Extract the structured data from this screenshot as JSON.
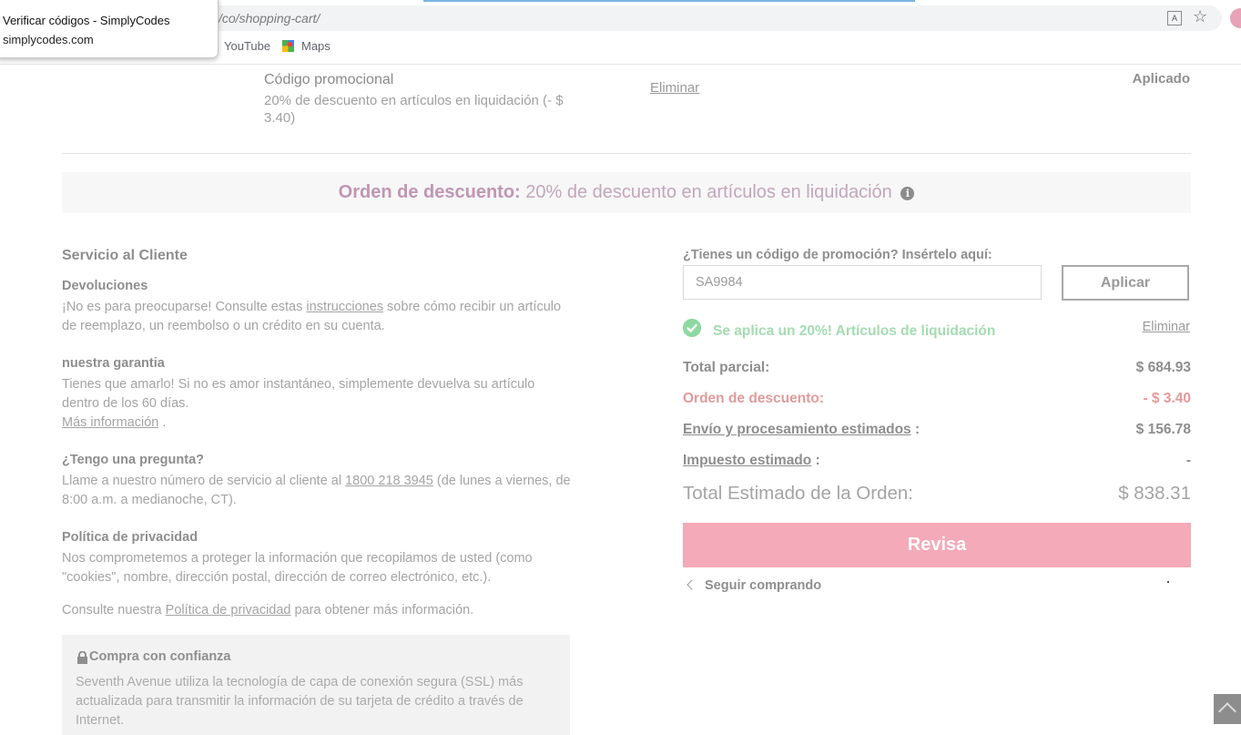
{
  "browser": {
    "url": "/co/shopping-cart/",
    "bookmarks": [
      "YouTube",
      "Maps"
    ],
    "popup_title": "Verificar códigos - SimplyCodes",
    "popup_subtitle": "simplycodes.com"
  },
  "promo_row": {
    "title": "Código promocional",
    "description": "20% de descuento en artículos en liquidación (- $ 3.40)",
    "remove_label": "Eliminar",
    "status": "Aplicado"
  },
  "banner": {
    "label": "Orden de descuento:",
    "text": "20% de descuento en artículos en liquidación"
  },
  "customer_service": {
    "title": "Servicio al Cliente",
    "returns_title": "Devoluciones",
    "returns_text_1": "¡No es para preocuparse! Consulte estas ",
    "returns_link": "instrucciones",
    "returns_text_2": " sobre cómo recibir un artículo de reemplazo, un reembolso o un crédito en su cuenta.",
    "guarantee_title": "nuestra garantia",
    "guarantee_text": "Tienes que amarlo! Si no es amor instantáneo, simplemente devuelva su artículo dentro de los 60 días.",
    "guarantee_link": "Más información",
    "question_title": "¿Tengo una pregunta?",
    "question_text_1": "Llame a nuestro número de servicio al cliente al ",
    "question_phone": "1800 218 3945",
    "question_text_2": " (de lunes a viernes, de 8:00 a.m. a medianoche, CT).",
    "privacy_title": "Política de privacidad",
    "privacy_text": "Nos comprometemos a proteger la información que recopilamos de usted (como \"cookies\", nombre, dirección postal, dirección de correo electrónico, etc.).",
    "privacy_consult_1": "Consulte nuestra ",
    "privacy_link": "Política de privacidad",
    "privacy_consult_2": " para obtener más información.",
    "trust_title": "Compra con confianza",
    "trust_text": "Seventh Avenue utiliza la tecnología de capa de conexión segura (SSL) más actualizada para transmitir la información de su tarjeta de crédito a través de Internet."
  },
  "promo_code": {
    "label": "¿Tienes un código de promoción? Insértelo aquí:",
    "value": "SA9984",
    "apply_label": "Aplicar",
    "success_text": "Se aplica un 20%! Artículos de liquidación",
    "remove_label": "Eliminar"
  },
  "summary": {
    "subtotal_label": "Total parcial:",
    "subtotal_value": "$ 684.93",
    "discount_label": "Orden de descuento:",
    "discount_value": "- $ 3.40",
    "shipping_label": "Envío y procesamiento estimados",
    "shipping_suffix": " :",
    "shipping_value": "$ 156.78",
    "tax_label": "Impuesto estimado",
    "tax_suffix": " :",
    "tax_value": "-",
    "total_label": "Total Estimado de la Orden:",
    "total_value": "$ 838.31"
  },
  "checkout_label": "Revisa",
  "continue_label": "Seguir comprando",
  "colors": {
    "accent_pink": "#f4aab8",
    "discount_red": "#e39a9a",
    "success_green": "#8ed8a1",
    "banner_label": "#c195b4"
  }
}
